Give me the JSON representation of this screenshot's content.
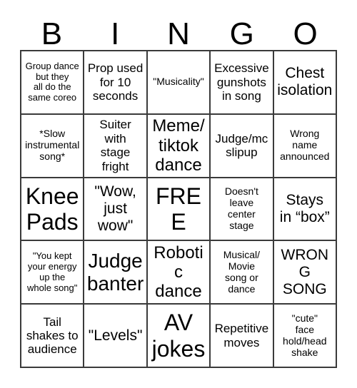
{
  "header": {
    "letters": [
      "B",
      "I",
      "N",
      "G",
      "O"
    ]
  },
  "grid": {
    "columns": 5,
    "rows": 5,
    "cells": [
      {
        "text": "Group dance\nbut they\nall do the\nsame coreo",
        "size": "xs"
      },
      {
        "text": "Prop used\nfor 10\nseconds",
        "size": "md"
      },
      {
        "text": "\"Musicality\"",
        "size": "sm"
      },
      {
        "text": "Excessive\ngunshots\nin song",
        "size": "md"
      },
      {
        "text": "Chest\nisolation",
        "size": "lg"
      },
      {
        "text": "*Slow\ninstrumental\nsong*",
        "size": "sm"
      },
      {
        "text": "Suiter\nwith\nstage\nfright",
        "size": "md"
      },
      {
        "text": "Meme/\ntiktok\ndance",
        "size": "xl"
      },
      {
        "text": "Judge/mc\nslipup",
        "size": "md"
      },
      {
        "text": "Wrong\nname\nannounced",
        "size": "sm"
      },
      {
        "text": "Knee\nPads",
        "size": "xxl"
      },
      {
        "text": "\"Wow,\njust\nwow\"",
        "size": "lg"
      },
      {
        "text": "FREE",
        "size": "xxl"
      },
      {
        "text": "Doesn't\nleave\ncenter\nstage",
        "size": "sm"
      },
      {
        "text": "Stays\nin “box”",
        "size": "lg"
      },
      {
        "text": "\"You kept\nyour energy\nup the\nwhole song\"",
        "size": "xs"
      },
      {
        "text": "Judge\nbanter",
        "size": "xxl"
      },
      {
        "text": "Robotic\ndance",
        "size": "xl"
      },
      {
        "text": "Musical/\nMovie\nsong or\ndance",
        "size": "sm"
      },
      {
        "text": "WRONG\nSONG",
        "size": "lg"
      },
      {
        "text": "Tail\nshakes to\naudience",
        "size": "md"
      },
      {
        "text": "\"Levels\"",
        "size": "lg"
      },
      {
        "text": "AV\njokes",
        "size": "xxl"
      },
      {
        "text": "Repetitive\nmoves",
        "size": "md"
      },
      {
        "text": "\"cute\"\nface\nhold/head\nshake",
        "size": "sm"
      }
    ]
  },
  "colors": {
    "background": "#ffffff",
    "border": "#3a3a3a",
    "text": "#000000"
  }
}
